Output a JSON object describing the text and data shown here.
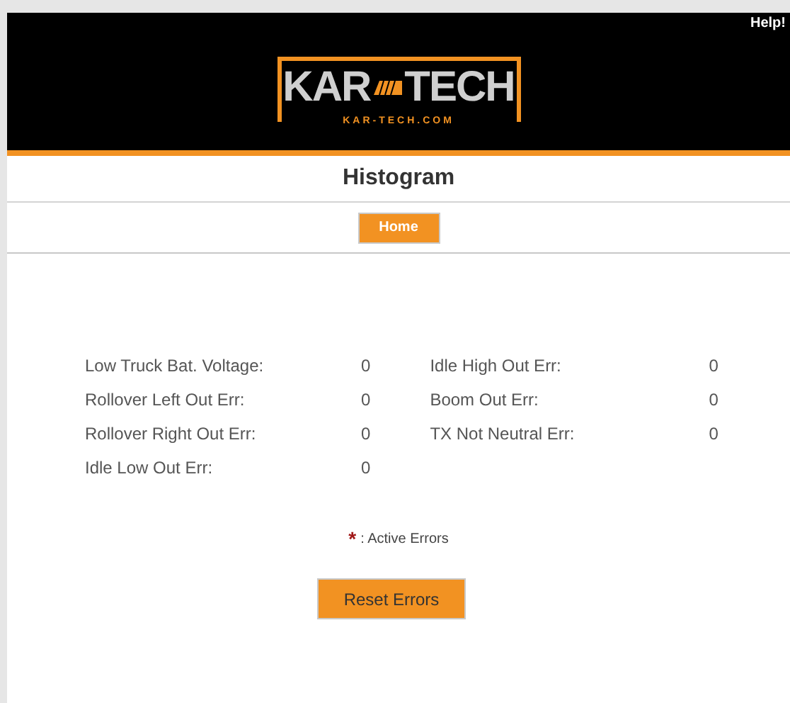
{
  "header": {
    "help_link": "Help!",
    "logo": {
      "left_word": "KAR",
      "right_word": "TECH",
      "url": "KAR-TECH.COM"
    }
  },
  "title": "Histogram",
  "nav": {
    "home_button": "Home"
  },
  "errors": {
    "left": [
      {
        "label": "Low Truck Bat. Voltage:",
        "value": "0"
      },
      {
        "label": "Rollover Left Out Err:",
        "value": "0"
      },
      {
        "label": "Rollover Right Out Err:",
        "value": "0"
      },
      {
        "label": "Idle Low Out Err:",
        "value": "0"
      }
    ],
    "right": [
      {
        "label": "Idle High Out Err:",
        "value": "0"
      },
      {
        "label": "Boom Out Err:",
        "value": "0"
      },
      {
        "label": "TX Not Neutral Err:",
        "value": "0"
      }
    ]
  },
  "legend": {
    "symbol": "*",
    "text": ": Active Errors"
  },
  "reset_button": "Reset Errors"
}
